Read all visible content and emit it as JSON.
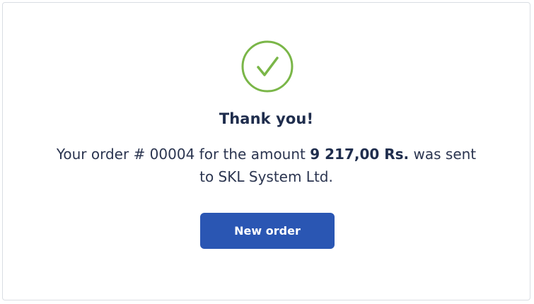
{
  "success_icon": {
    "name": "check-circle-icon",
    "color": "#7ab648"
  },
  "confirmation": {
    "title": "Thank you!",
    "message_prefix": "Your order # 00004 for the amount ",
    "amount": "9 217,00 Rs.",
    "message_mid": " was sent",
    "message_suffix": "to SKL System Ltd."
  },
  "actions": {
    "new_order_label": "New order",
    "button_color": "#2a56b3"
  }
}
